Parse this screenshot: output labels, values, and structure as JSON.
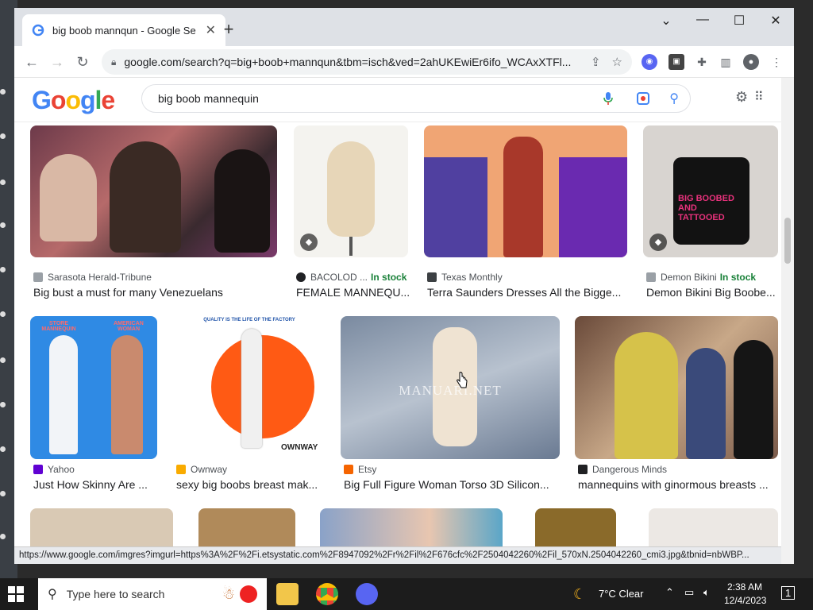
{
  "browser": {
    "tab_title": "big boob mannqun - Google Se",
    "url": "google.com/search?q=big+boob+mannqun&tbm=isch&ved=2ahUKEwiEr6ifo_WCAxXTFl...",
    "status_url": "https://www.google.com/imgres?imgurl=https%3A%2F%2Fi.etsystatic.com%2F8947092%2Fr%2Fil%2F676cfc%2F2504042260%2Fil_570xN.2504042260_cmi3.jpg&tbnid=nbWBP..."
  },
  "google": {
    "logo_letters": [
      "G",
      "o",
      "o",
      "g",
      "l",
      "e"
    ],
    "query": "big boob mannequin"
  },
  "results": [
    {
      "source": "Sarasota Herald-Tribune",
      "title": "Big bust a must for many Venezuelans",
      "stock": "",
      "source_icon_color": "#9aa0a6"
    },
    {
      "source": "BACOLOD ...",
      "title": "FEMALE MANNEQU...",
      "stock": "In stock",
      "source_icon_color": "#202124"
    },
    {
      "source": "Texas Monthly",
      "title": "Terra Saunders Dresses All the Bigge...",
      "stock": "",
      "source_icon_color": "#3c4043"
    },
    {
      "source": "Demon Bikini",
      "title": "Demon Bikini Big Boobe...",
      "stock": "In stock",
      "source_icon_color": "#9aa0a6"
    },
    {
      "source": "Yahoo",
      "title": "Just How Skinny Are ...",
      "stock": "",
      "source_icon_color": "#6001d2"
    },
    {
      "source": "Ownway",
      "title": "sexy big boobs breast mak...",
      "stock": "",
      "source_icon_color": "#f9ab00"
    },
    {
      "source": "Etsy",
      "title": "Big Full Figure Woman Torso 3D Silicon...",
      "stock": "",
      "source_icon_color": "#f56400"
    },
    {
      "source": "Dangerous Minds",
      "title": "mannequins with ginormous breasts ...",
      "stock": "",
      "source_icon_color": "#202124"
    }
  ],
  "image_text": {
    "demon_shirt": "BIG BOOBED AND TATTOOED",
    "etsy_watermark": "MANUARI.NET",
    "ownway_logo": "OWNWAY",
    "ownway_banner": "QUALITY IS THE LIFE OF THE FACTORY",
    "yahoo_left": "STORE MANNEQUIN",
    "yahoo_right": "AMERICAN WOMAN"
  },
  "taskbar": {
    "search_placeholder": "Type here to search",
    "weather": "7°C  Clear",
    "time": "2:38 AM",
    "date": "12/4/2023",
    "notifications": "1"
  }
}
